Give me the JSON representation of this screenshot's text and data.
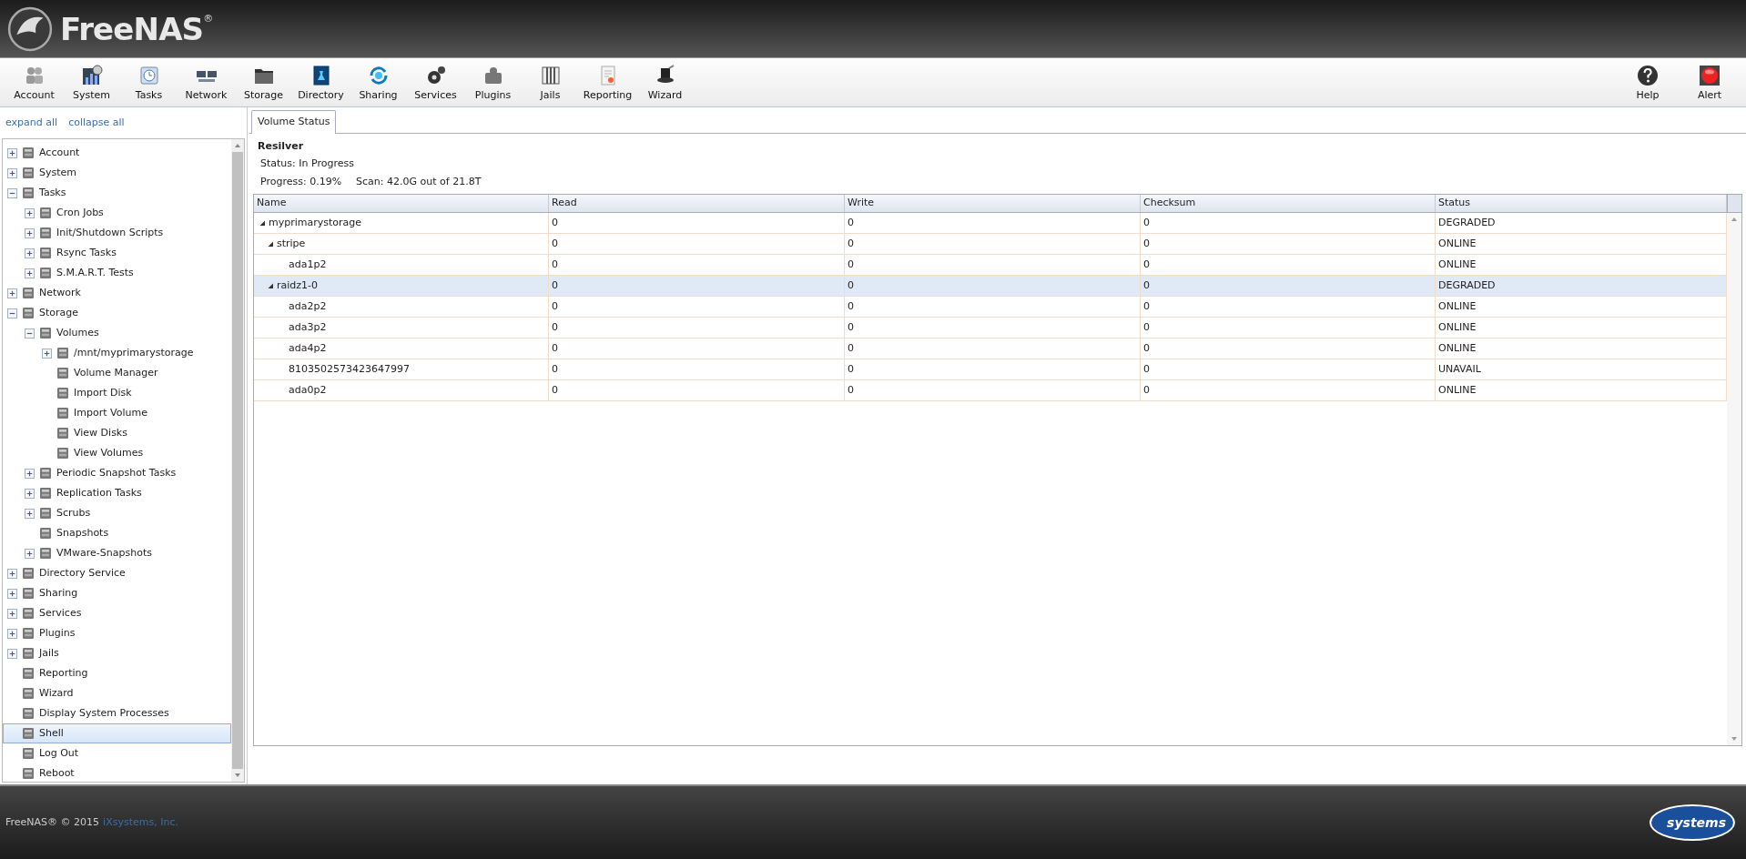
{
  "header": {
    "logo_text": "FreeNAS",
    "logo_mark": "®"
  },
  "toolbar": {
    "left": [
      {
        "label": "Account"
      },
      {
        "label": "System"
      },
      {
        "label": "Tasks"
      },
      {
        "label": "Network"
      },
      {
        "label": "Storage"
      },
      {
        "label": "Directory"
      },
      {
        "label": "Sharing"
      },
      {
        "label": "Services"
      },
      {
        "label": "Plugins"
      },
      {
        "label": "Jails"
      },
      {
        "label": "Reporting"
      },
      {
        "label": "Wizard"
      }
    ],
    "right": [
      {
        "label": "Help"
      },
      {
        "label": "Alert"
      }
    ]
  },
  "sidebar": {
    "links": [
      "expand all",
      "collapse all"
    ],
    "tree": [
      {
        "label": "Account",
        "kind": "folder",
        "expanded": false,
        "selected": false
      },
      {
        "label": "System",
        "kind": "folder",
        "expanded": false,
        "selected": false
      },
      {
        "label": "Tasks",
        "kind": "folder",
        "expanded": true,
        "selected": false,
        "children": [
          {
            "label": "Cron Jobs",
            "kind": "folder",
            "expanded": false,
            "selected": false
          },
          {
            "label": "Init/Shutdown Scripts",
            "kind": "folder",
            "expanded": false,
            "selected": false
          },
          {
            "label": "Rsync Tasks",
            "kind": "folder",
            "expanded": false,
            "selected": false
          },
          {
            "label": "S.M.A.R.T. Tests",
            "kind": "folder",
            "expanded": false,
            "selected": false
          }
        ]
      },
      {
        "label": "Network",
        "kind": "folder",
        "expanded": false,
        "selected": false
      },
      {
        "label": "Storage",
        "kind": "folder",
        "expanded": true,
        "selected": false,
        "children": [
          {
            "label": "Volumes",
            "kind": "folder",
            "expanded": true,
            "selected": false,
            "children": [
              {
                "label": "/mnt/myprimarystorage",
                "kind": "folder",
                "expanded": false,
                "selected": false
              },
              {
                "label": "Volume Manager",
                "kind": "leaf",
                "selected": false
              },
              {
                "label": "Import Disk",
                "kind": "leaf",
                "selected": false
              },
              {
                "label": "Import Volume",
                "kind": "leaf",
                "selected": false
              },
              {
                "label": "View Disks",
                "kind": "leaf",
                "selected": false
              },
              {
                "label": "View Volumes",
                "kind": "leaf",
                "selected": false
              }
            ]
          },
          {
            "label": "Periodic Snapshot Tasks",
            "kind": "folder",
            "expanded": false,
            "selected": false
          },
          {
            "label": "Replication Tasks",
            "kind": "folder",
            "expanded": false,
            "selected": false
          },
          {
            "label": "Scrubs",
            "kind": "folder",
            "expanded": false,
            "selected": false
          },
          {
            "label": "Snapshots",
            "kind": "leaf",
            "selected": false
          },
          {
            "label": "VMware-Snapshots",
            "kind": "folder",
            "expanded": false,
            "selected": false
          }
        ]
      },
      {
        "label": "Directory Service",
        "kind": "folder",
        "expanded": false,
        "selected": false
      },
      {
        "label": "Sharing",
        "kind": "folder",
        "expanded": false,
        "selected": false
      },
      {
        "label": "Services",
        "kind": "folder",
        "expanded": false,
        "selected": false
      },
      {
        "label": "Plugins",
        "kind": "folder",
        "expanded": false,
        "selected": false
      },
      {
        "label": "Jails",
        "kind": "folder",
        "expanded": false,
        "selected": false
      },
      {
        "label": "Reporting",
        "kind": "leaf",
        "selected": false
      },
      {
        "label": "Wizard",
        "kind": "leaf",
        "selected": false
      },
      {
        "label": "Display System Processes",
        "kind": "leaf",
        "selected": false
      },
      {
        "label": "Shell",
        "kind": "leaf",
        "selected": true
      },
      {
        "label": "Log Out",
        "kind": "leaf",
        "selected": false
      },
      {
        "label": "Reboot",
        "kind": "leaf",
        "selected": false
      }
    ]
  },
  "tabs": [
    {
      "label": "Volume Status",
      "selected": true
    }
  ],
  "resilver": {
    "title": "Resilver",
    "status": "Status: In Progress",
    "progress": "Progress: 0.19%",
    "scan": "Scan: 42.0G out of 21.8T"
  },
  "table": {
    "columns": [
      "Name",
      "Read",
      "Write",
      "Checksum",
      "Status"
    ],
    "rows": [
      {
        "name": "myprimarystorage",
        "read": "0",
        "write": "0",
        "checksum": "0",
        "status": "DEGRADED",
        "selected": false,
        "expanded": true,
        "children": [
          {
            "name": "stripe",
            "read": "0",
            "write": "0",
            "checksum": "0",
            "status": "ONLINE",
            "selected": false,
            "expanded": true,
            "children": [
              {
                "name": "ada1p2",
                "read": "0",
                "write": "0",
                "checksum": "0",
                "status": "ONLINE",
                "selected": false
              }
            ]
          },
          {
            "name": "raidz1-0",
            "read": "0",
            "write": "0",
            "checksum": "0",
            "status": "DEGRADED",
            "selected": true,
            "expanded": true,
            "children": [
              {
                "name": "ada2p2",
                "read": "0",
                "write": "0",
                "checksum": "0",
                "status": "ONLINE",
                "selected": false
              },
              {
                "name": "ada3p2",
                "read": "0",
                "write": "0",
                "checksum": "0",
                "status": "ONLINE",
                "selected": false
              },
              {
                "name": "ada4p2",
                "read": "0",
                "write": "0",
                "checksum": "0",
                "status": "ONLINE",
                "selected": false
              },
              {
                "name": "8103502573423647997",
                "read": "0",
                "write": "0",
                "checksum": "0",
                "status": "UNAVAIL",
                "selected": false
              },
              {
                "name": "ada0p2",
                "read": "0",
                "write": "0",
                "checksum": "0",
                "status": "ONLINE",
                "selected": false
              }
            ]
          }
        ]
      }
    ]
  },
  "footer": {
    "copyright": "FreeNAS® © 2015",
    "company_link": "iXsystems, Inc.",
    "logo_text": "systems"
  }
}
